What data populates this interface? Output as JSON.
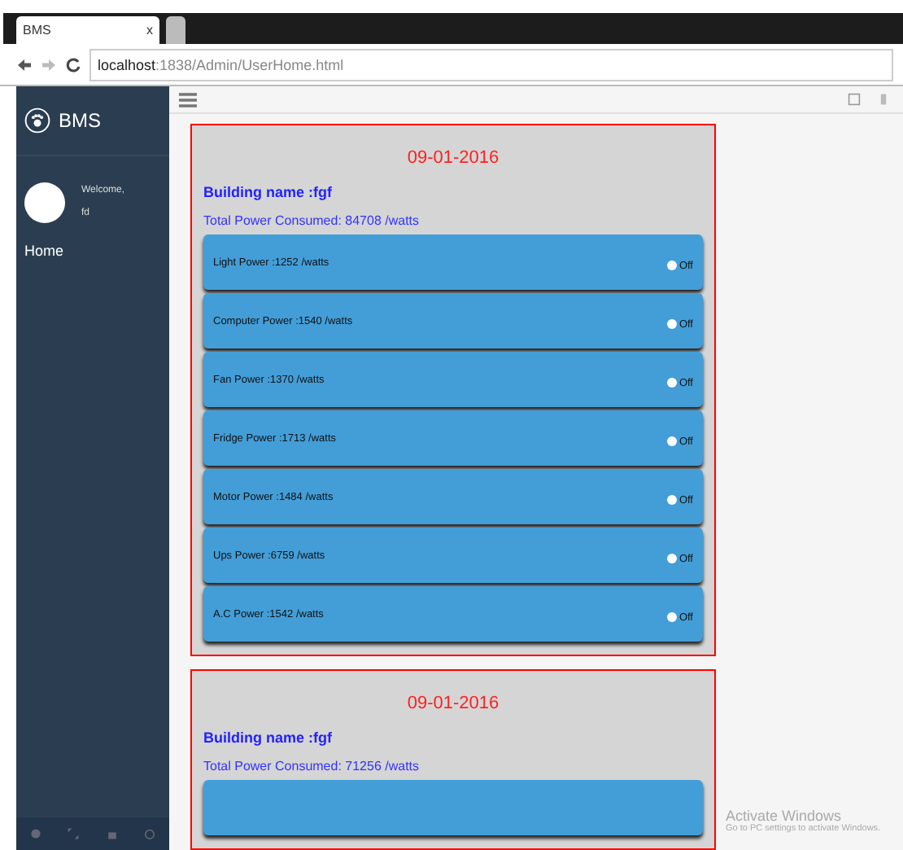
{
  "browser": {
    "tabs": [
      {
        "title": "BMS",
        "close": "x",
        "selected": true
      },
      {
        "selected": false
      }
    ],
    "address": "**localhost**:1838/Admin/UserHome.html"
  },
  "sidebar": {
    "brand": "BMS",
    "welcome": "Welcome,",
    "user": "fd",
    "nav": [
      {
        "label": "Home"
      }
    ]
  },
  "cards": [
    {
      "date": "09-01-2016",
      "building": "Building name :fgf",
      "total": "Total Power Consumed: 84708 /watts",
      "devices": [
        {
          "label": "Light Power :1252 /watts",
          "on": false,
          "state": "Off"
        },
        {
          "label": "Computer Power :1540 /watts",
          "on": false,
          "state": "Off"
        },
        {
          "label": "Fan Power :1370 /watts",
          "on": false,
          "state": "Off"
        },
        {
          "label": "Fridge Power :1713 /watts",
          "on": false,
          "state": "Off"
        },
        {
          "label": "Motor Power :1484 /watts",
          "on": false,
          "state": "Off"
        },
        {
          "label": "Ups Power :6759 /watts",
          "on": false,
          "state": "Off"
        },
        {
          "label": "A.C Power :1542 /watts",
          "on": false,
          "state": "Off"
        }
      ]
    },
    {
      "date": "09-01-2016",
      "building": "Building name :fgf",
      "total": "Total Power Consumed: 71256 /watts",
      "devices": [
        {
          "kind": "cut"
        }
      ]
    }
  ],
  "os_notice": {
    "title": "Activate Windows",
    "text": "Go to PC settings to activate Windows."
  }
}
